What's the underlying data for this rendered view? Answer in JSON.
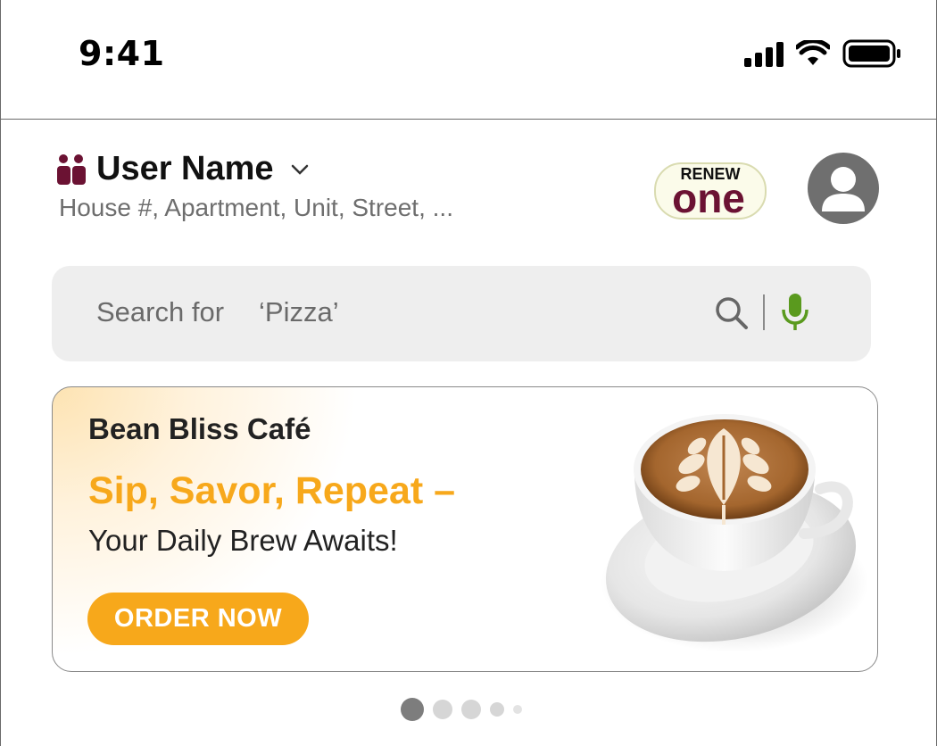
{
  "status_bar": {
    "time": "9:41",
    "icons": [
      "cellular-signal-icon",
      "wifi-icon",
      "battery-icon"
    ]
  },
  "header": {
    "user_icon": "users-icon",
    "user_name": "User Name",
    "dropdown_icon": "chevron-down-icon",
    "address": "House #, Apartment, Unit, Street, ...",
    "logo": {
      "top_text": "RENEW",
      "main_text": "one"
    },
    "avatar_icon": "profile-icon"
  },
  "search": {
    "label": "Search for",
    "term": "‘Pizza’",
    "search_icon": "search-icon",
    "mic_icon": "microphone-icon"
  },
  "banner": {
    "brand": "Bean Bliss Café",
    "headline": "Sip, Savor, Repeat –",
    "subline": "Your Daily Brew Awaits!",
    "cta_label": "ORDER NOW",
    "image": "latte-cup-image"
  },
  "carousel": {
    "total": 5,
    "active_index": 0
  },
  "colors": {
    "accent": "#f7a81b",
    "logo_maroon": "#6b1233",
    "mic_green": "#5a9a1e",
    "search_bg": "#eeeeee",
    "avatar": "#6f6f6f"
  }
}
